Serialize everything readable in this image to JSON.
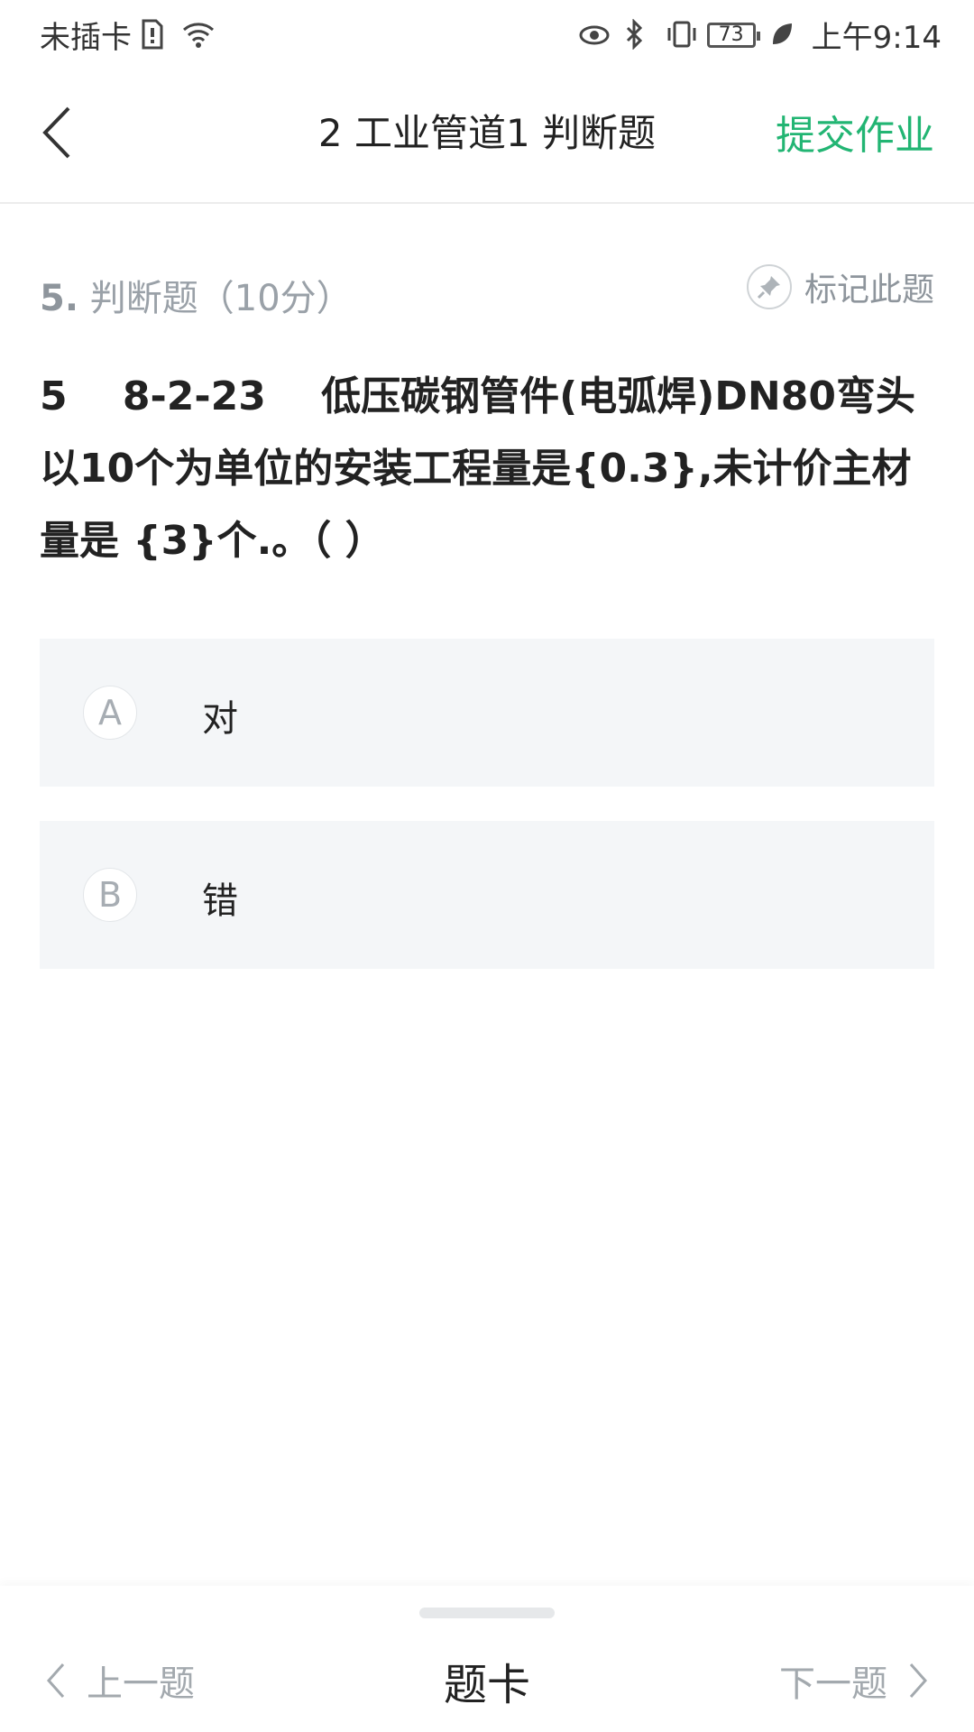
{
  "status_bar": {
    "carrier": "未插卡",
    "battery": "73",
    "time": "上午9:14"
  },
  "header": {
    "title": "2 工业管道1 判断题",
    "submit_label": "提交作业",
    "accent_color": "#22b573"
  },
  "question": {
    "number": "5.",
    "type_score": "判断题（10分）",
    "mark_label": "标记此题",
    "text": "5    8-2-23    低压碳钢管件(电弧焊)DN80弯头    以10个为单位的安装工程量是{0.3},未计价主材量是 {3}个.。（ ）",
    "options": [
      {
        "letter": "A",
        "text": "对"
      },
      {
        "letter": "B",
        "text": "错"
      }
    ]
  },
  "bottom_bar": {
    "prev_label": "上一题",
    "card_label": "题卡",
    "next_label": "下一题"
  }
}
